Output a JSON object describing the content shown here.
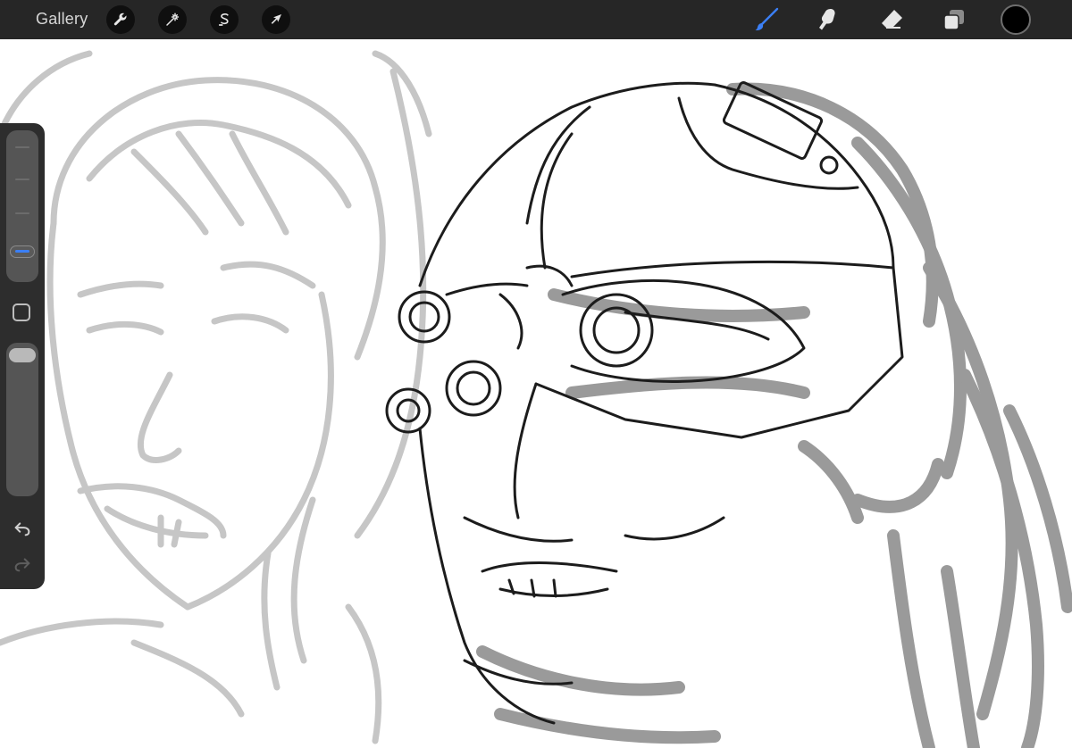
{
  "toolbar": {
    "gallery_label": "Gallery",
    "left_tools": [
      {
        "name": "actions",
        "icon": "wrench-icon"
      },
      {
        "name": "adjustments",
        "icon": "magic-wand-icon"
      },
      {
        "name": "selection",
        "icon": "selection-s-icon"
      },
      {
        "name": "transform",
        "icon": "arrow-cursor-icon"
      }
    ],
    "right_tools": [
      {
        "name": "brush",
        "icon": "brush-icon",
        "active": true
      },
      {
        "name": "smudge",
        "icon": "smudge-finger-icon",
        "active": false
      },
      {
        "name": "eraser",
        "icon": "eraser-icon",
        "active": false
      },
      {
        "name": "layers",
        "icon": "layers-icon",
        "active": false
      }
    ],
    "current_color": "#000000",
    "accent_color": "#3b7ff5"
  },
  "sidebar": {
    "brush_size_level": 0.15,
    "brush_opacity_level": 1.0,
    "icons": [
      "modify-square-icon",
      "undo-icon",
      "redo-icon"
    ]
  }
}
